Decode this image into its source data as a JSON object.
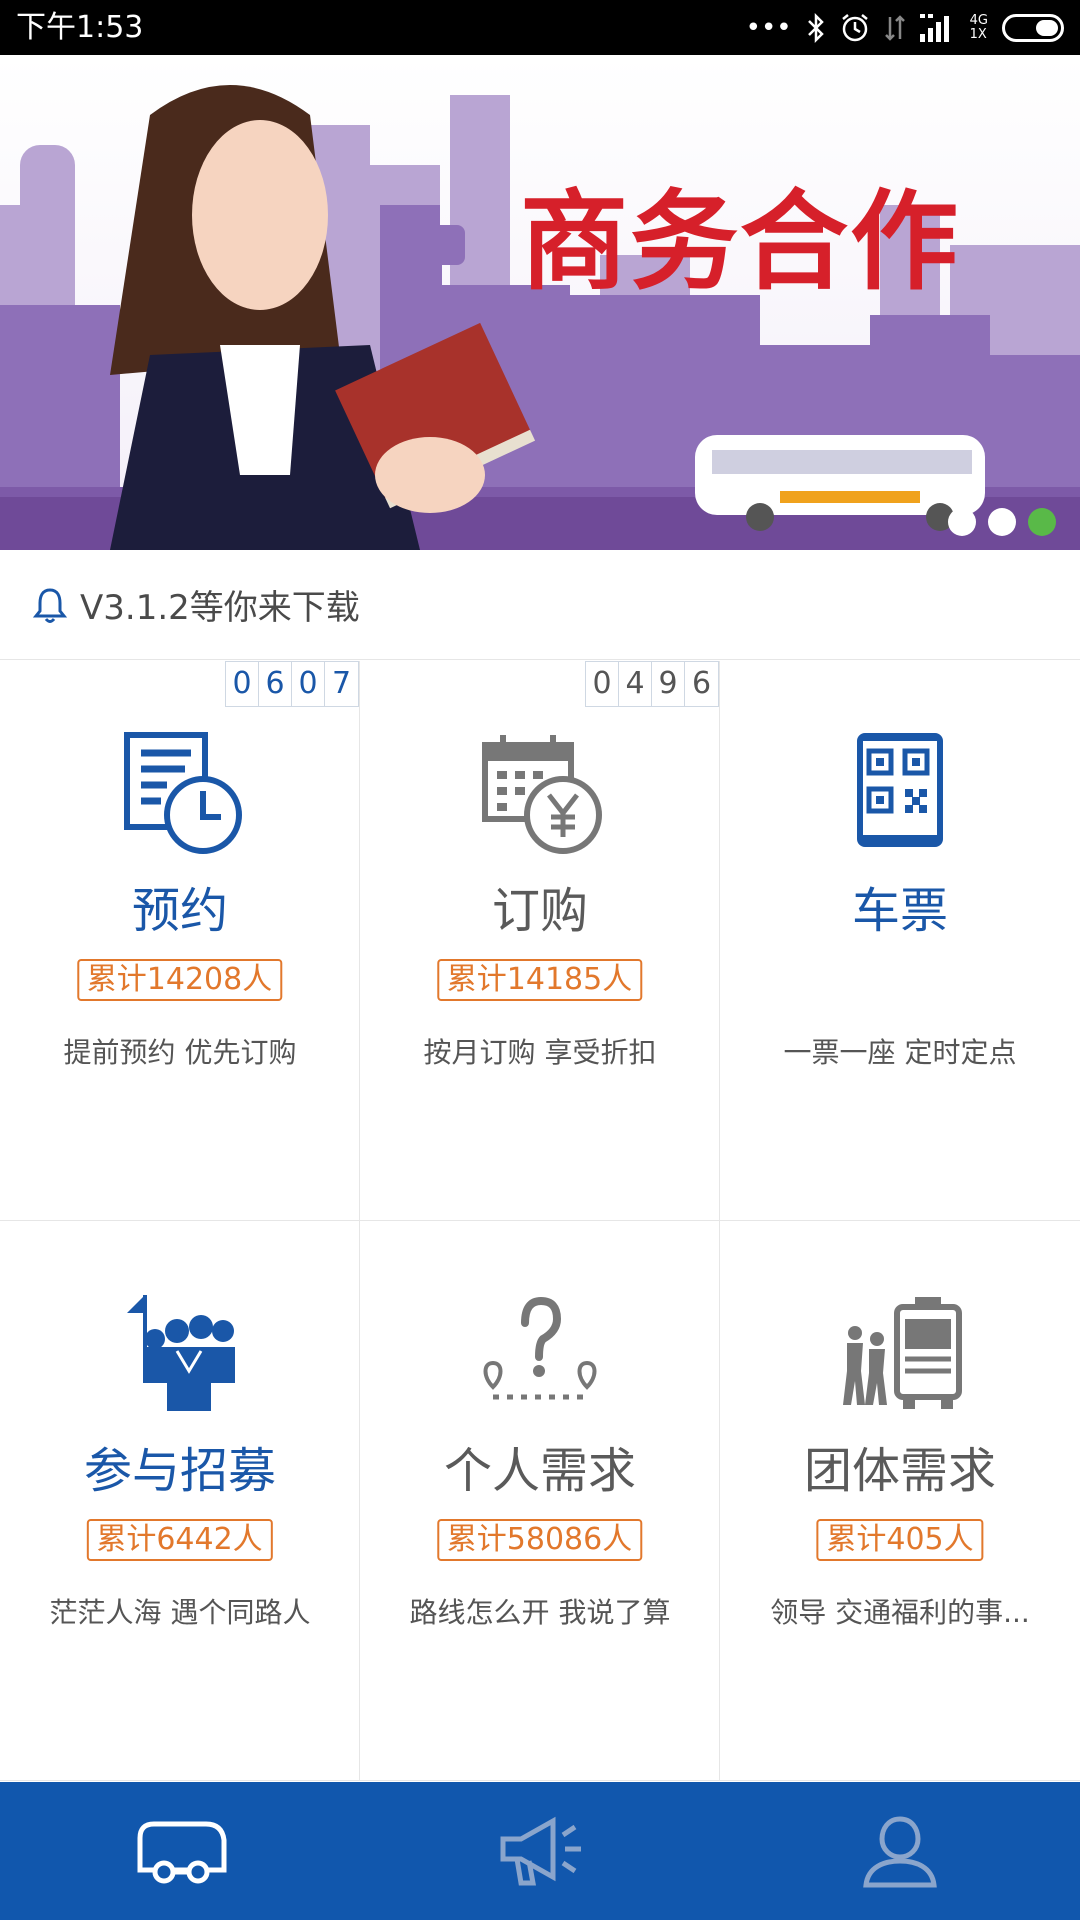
{
  "status_bar": {
    "time": "下午1:53",
    "network_top": "4G",
    "network_bottom": "1X",
    "icons": [
      "more-dots-icon",
      "bluetooth-icon",
      "alarm-icon",
      "data-arrows-icon",
      "signal-icon",
      "battery-icon"
    ]
  },
  "banner": {
    "title": "商务合作",
    "page_count": 3,
    "active_page": 3,
    "colors": {
      "title": "#d6202a",
      "city": "#8a6ab3",
      "active_dot": "#59b948"
    }
  },
  "notice": {
    "icon": "bell-icon",
    "text": "V3.1.2等你来下载"
  },
  "features": [
    {
      "title": "预约",
      "count": "累计14208人",
      "desc": "提前预约  优先订购",
      "icon": "reservation-clock-icon",
      "tone": "blue",
      "counter": [
        "0",
        "6",
        "0",
        "7"
      ]
    },
    {
      "title": "订购",
      "count": "累计14185人",
      "desc": "按月订购  享受折扣",
      "icon": "calendar-yuan-icon",
      "tone": "gray",
      "counter": [
        "0",
        "4",
        "9",
        "6"
      ]
    },
    {
      "title": "车票",
      "count": "",
      "desc": "一票一座  定时定点",
      "icon": "qr-ticket-icon",
      "tone": "blue",
      "counter": []
    },
    {
      "title": "参与招募",
      "count": "累计6442人",
      "desc": "茫茫人海  遇个同路人",
      "icon": "group-flag-icon",
      "tone": "blue",
      "counter": []
    },
    {
      "title": "个人需求",
      "count": "累计58086人",
      "desc": "路线怎么开  我说了算",
      "icon": "route-question-icon",
      "tone": "gray",
      "counter": []
    },
    {
      "title": "团体需求",
      "count": "累计405人",
      "desc": "领导  交通福利的事...",
      "icon": "bus-people-icon",
      "tone": "gray",
      "counter": []
    }
  ],
  "bottom_nav": [
    {
      "icon": "bus-icon",
      "active": true
    },
    {
      "icon": "megaphone-icon",
      "active": false
    },
    {
      "icon": "user-icon",
      "active": false
    }
  ],
  "colors": {
    "brand_blue": "#1157ad",
    "accent_orange": "#e2782c",
    "text_blue": "#1a57a8"
  }
}
